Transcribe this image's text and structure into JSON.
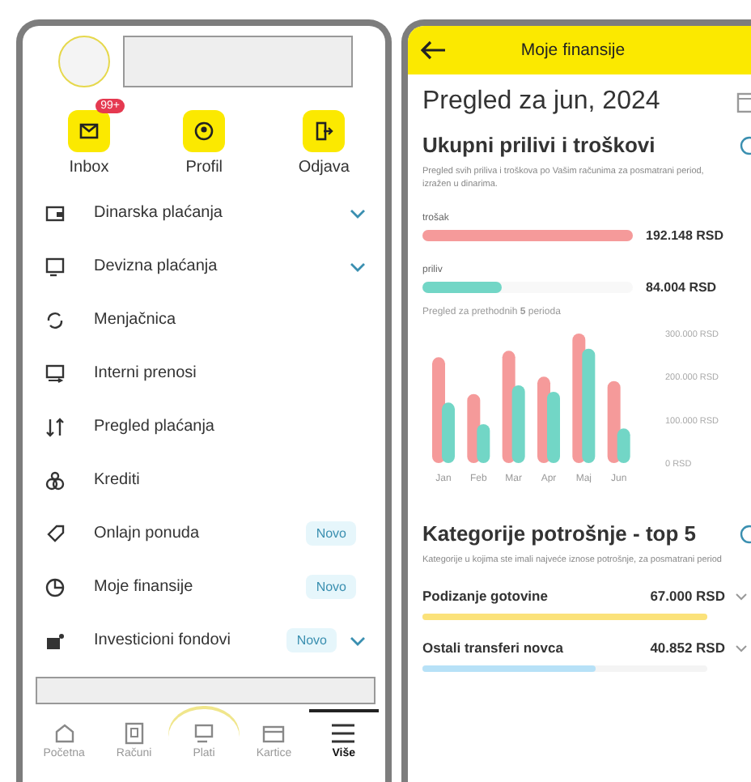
{
  "menu_screen": {
    "shortcuts": [
      {
        "label": "Inbox",
        "badge": "99+",
        "kind": "inbox"
      },
      {
        "label": "Profil",
        "kind": "profile"
      },
      {
        "label": "Odjava",
        "kind": "logout"
      }
    ],
    "items": [
      {
        "label": "Dinarska plaćanja",
        "kind": "wallet",
        "has_submenu": true
      },
      {
        "label": "Devizna plaćanja",
        "kind": "currency",
        "has_submenu": true
      },
      {
        "label": "Menjačnica",
        "kind": "exchange",
        "has_submenu": false
      },
      {
        "label": "Interni prenosi",
        "kind": "transfer",
        "has_submenu": false
      },
      {
        "label": "Pregled plaćanja",
        "kind": "arrows",
        "has_submenu": false
      },
      {
        "label": "Krediti",
        "kind": "coins",
        "has_submenu": false
      },
      {
        "label": "Onlajn ponuda",
        "kind": "tag",
        "badge": "Novo",
        "has_submenu": false
      },
      {
        "label": "Moje finansije",
        "kind": "pie",
        "badge": "Novo",
        "has_submenu": false
      },
      {
        "label": "Investicioni fondovi",
        "kind": "fund",
        "badge": "Novo",
        "has_submenu": true
      }
    ],
    "bottom_nav": [
      {
        "label": "Početna",
        "kind": "home",
        "selected": false
      },
      {
        "label": "Računi",
        "kind": "accounts",
        "selected": false
      },
      {
        "label": "Plati",
        "kind": "pay",
        "selected": false
      },
      {
        "label": "Kartice",
        "kind": "card",
        "selected": false
      },
      {
        "label": "Više",
        "kind": "more",
        "selected": true
      }
    ]
  },
  "finance_screen": {
    "title": "Moje finansije",
    "heading": "Pregled za jun, 2024",
    "totals": {
      "title": "Ukupni prilivi i troškovi",
      "description": "Pregled svih priliva i troškova po Vašim računima za posmatrani period, izražen u dinarima.",
      "bars": [
        {
          "label": "trošak",
          "value": "192.148 RSD",
          "level": 1,
          "color": "#f59a9a"
        },
        {
          "label": "priliv",
          "value": "84.004 RSD",
          "level": 0.38,
          "color": "#72d6c6"
        }
      ],
      "chart_caption": "Pregled za prethodnih **5** perioda",
      "chart_data": {
        "type": "bar",
        "categories": [
          "Jan",
          "Feb",
          "Mar",
          "Apr",
          "Maj",
          "Jun"
        ],
        "series": [
          {
            "color": "#f59a9a",
            "values": [
              245000,
              160000,
              260000,
              200000,
              300000,
              190000
            ]
          },
          {
            "color": "#72d6c6",
            "values": [
              140000,
              90000,
              180000,
              165000,
              265000,
              80000
            ]
          }
        ],
        "ylim": [
          0,
          300000
        ],
        "yticks": [
          {
            "value": 0,
            "label": "0 RSD"
          },
          {
            "value": 100000,
            "label": "100.000 RSD"
          },
          {
            "value": 200000,
            "label": "200.000 RSD"
          },
          {
            "value": 300000,
            "label": "300.000 RSD"
          }
        ]
      }
    },
    "categories": {
      "title": "Kategorije potrošnje - top 5",
      "description": "Kategorije u kojima ste imali najveće iznose potrošnje, za posmatrani period",
      "items": [
        {
          "label": "Podizanje gotovine",
          "value": "67.000 RSD",
          "level": 1,
          "color": "#fbe27a"
        },
        {
          "label": "Ostali transferi novca",
          "value": "40.852 RSD",
          "level": 0.61,
          "color": "#b7e1f7"
        }
      ]
    }
  }
}
